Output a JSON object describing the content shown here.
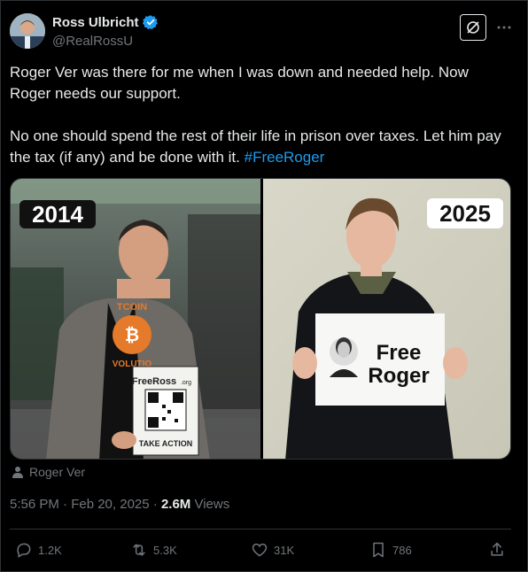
{
  "author": {
    "name": "Ross Ulbricht",
    "handle": "@RealRossU"
  },
  "tweet": {
    "text_part1": "Roger Ver was there for me when I was down and needed help. Now Roger needs our support.\n\nNo one should spend the rest of their life in prison over taxes. Let him pay the tax (if any) and be done with it. ",
    "hashtag": "#FreeRoger"
  },
  "media": {
    "left_year": "2014",
    "right_year": "2025",
    "left_shirt_text": "TCOIN",
    "left_shirt_text_bottom": "VOLUTIO",
    "left_sign_title": "FreeRoss",
    "left_sign_suffix": ".org",
    "left_sign_footer": "TAKE ACTION",
    "right_sign_line1": "Free",
    "right_sign_line2": "Roger"
  },
  "tagged": "Roger Ver",
  "meta": {
    "time": "5:56 PM · Feb 20, 2025 · ",
    "views_count": "2.6M",
    "views_label": " Views"
  },
  "actions": {
    "replies": "1.2K",
    "reposts": "5.3K",
    "likes": "31K",
    "bookmarks": "786"
  },
  "colors": {
    "background": "#000000",
    "text": "#e7e9ea",
    "secondary": "#71767b",
    "accent": "#1d9bf0",
    "border": "#2f3336"
  }
}
